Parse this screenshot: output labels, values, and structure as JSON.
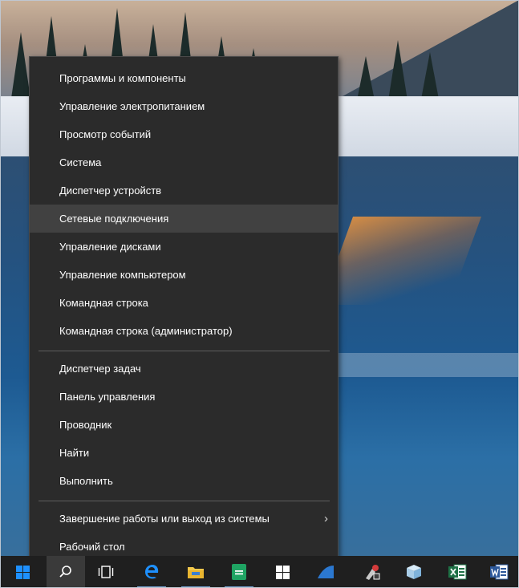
{
  "menu": {
    "items": [
      {
        "label": "Программы и компоненты"
      },
      {
        "label": "Управление электропитанием"
      },
      {
        "label": "Просмотр событий"
      },
      {
        "label": "Система"
      },
      {
        "label": "Диспетчер устройств"
      },
      {
        "label": "Сетевые подключения",
        "highlighted": true
      },
      {
        "label": "Управление дисками"
      },
      {
        "label": "Управление компьютером"
      },
      {
        "label": "Командная строка"
      },
      {
        "label": "Командная строка (администратор)"
      },
      {
        "label": "Диспетчер задач"
      },
      {
        "label": "Панель управления"
      },
      {
        "label": "Проводник"
      },
      {
        "label": "Найти"
      },
      {
        "label": "Выполнить"
      },
      {
        "label": "Завершение работы или выход из системы",
        "submenu_icon": "chevron-right-icon",
        "submenu_glyph": "›"
      },
      {
        "label": "Рабочий стол"
      }
    ]
  },
  "taskbar": {
    "icons": [
      {
        "name": "start-button",
        "icon": "windows-logo-icon"
      },
      {
        "name": "search-button",
        "icon": "search-icon"
      },
      {
        "name": "task-view-button",
        "icon": "task-view-icon"
      },
      {
        "name": "edge-button",
        "icon": "edge-browser-icon"
      },
      {
        "name": "file-explorer-button",
        "icon": "folder-icon"
      },
      {
        "name": "spreadsheet-app-button",
        "icon": "green-document-icon"
      },
      {
        "name": "store-button",
        "icon": "store-icon"
      },
      {
        "name": "app-button",
        "icon": "blue-triangle-icon"
      },
      {
        "name": "app-button-2",
        "icon": "tools-icon"
      },
      {
        "name": "app-button-3",
        "icon": "cube-icon"
      },
      {
        "name": "excel-button",
        "icon": "excel-icon"
      },
      {
        "name": "word-button",
        "icon": "word-icon"
      }
    ]
  },
  "colors": {
    "menu_bg": "#2b2b2b",
    "menu_hover": "#414141",
    "menu_text": "#ffffff",
    "taskbar_bg": "#1f1f1f",
    "accent": "#1e90ff"
  }
}
